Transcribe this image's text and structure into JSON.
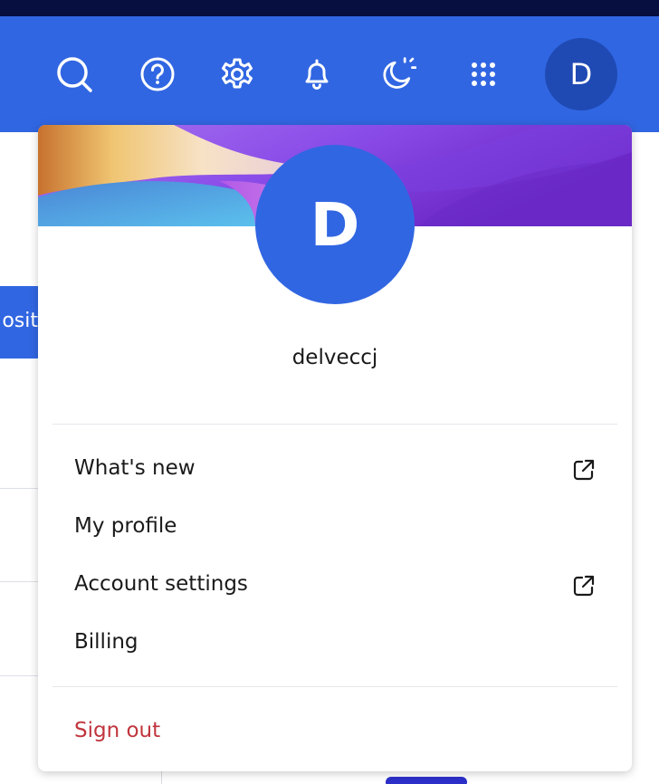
{
  "header": {
    "icons": [
      "search-icon",
      "help-icon",
      "settings-icon",
      "notifications-bell-icon",
      "theme-moon-sun-icon",
      "apps-grid-icon"
    ],
    "avatar_initial": "D",
    "colors": {
      "header_bg": "#3166e2",
      "top_strip": "#070e40",
      "avatar_bg": "#1f4ab4"
    }
  },
  "background": {
    "button_partial_text": "osit"
  },
  "profile_menu": {
    "avatar_initial": "D",
    "username": "delveccj",
    "items": [
      {
        "label": "What's new",
        "external": true,
        "icon": "external-link-icon"
      },
      {
        "label": "My profile",
        "external": false
      },
      {
        "label": "Account settings",
        "external": true,
        "icon": "external-link-icon"
      },
      {
        "label": "Billing",
        "external": false
      }
    ],
    "sign_out": "Sign out",
    "colors": {
      "avatar_bg": "#3166e2",
      "sign_out": "#c0353d"
    }
  }
}
